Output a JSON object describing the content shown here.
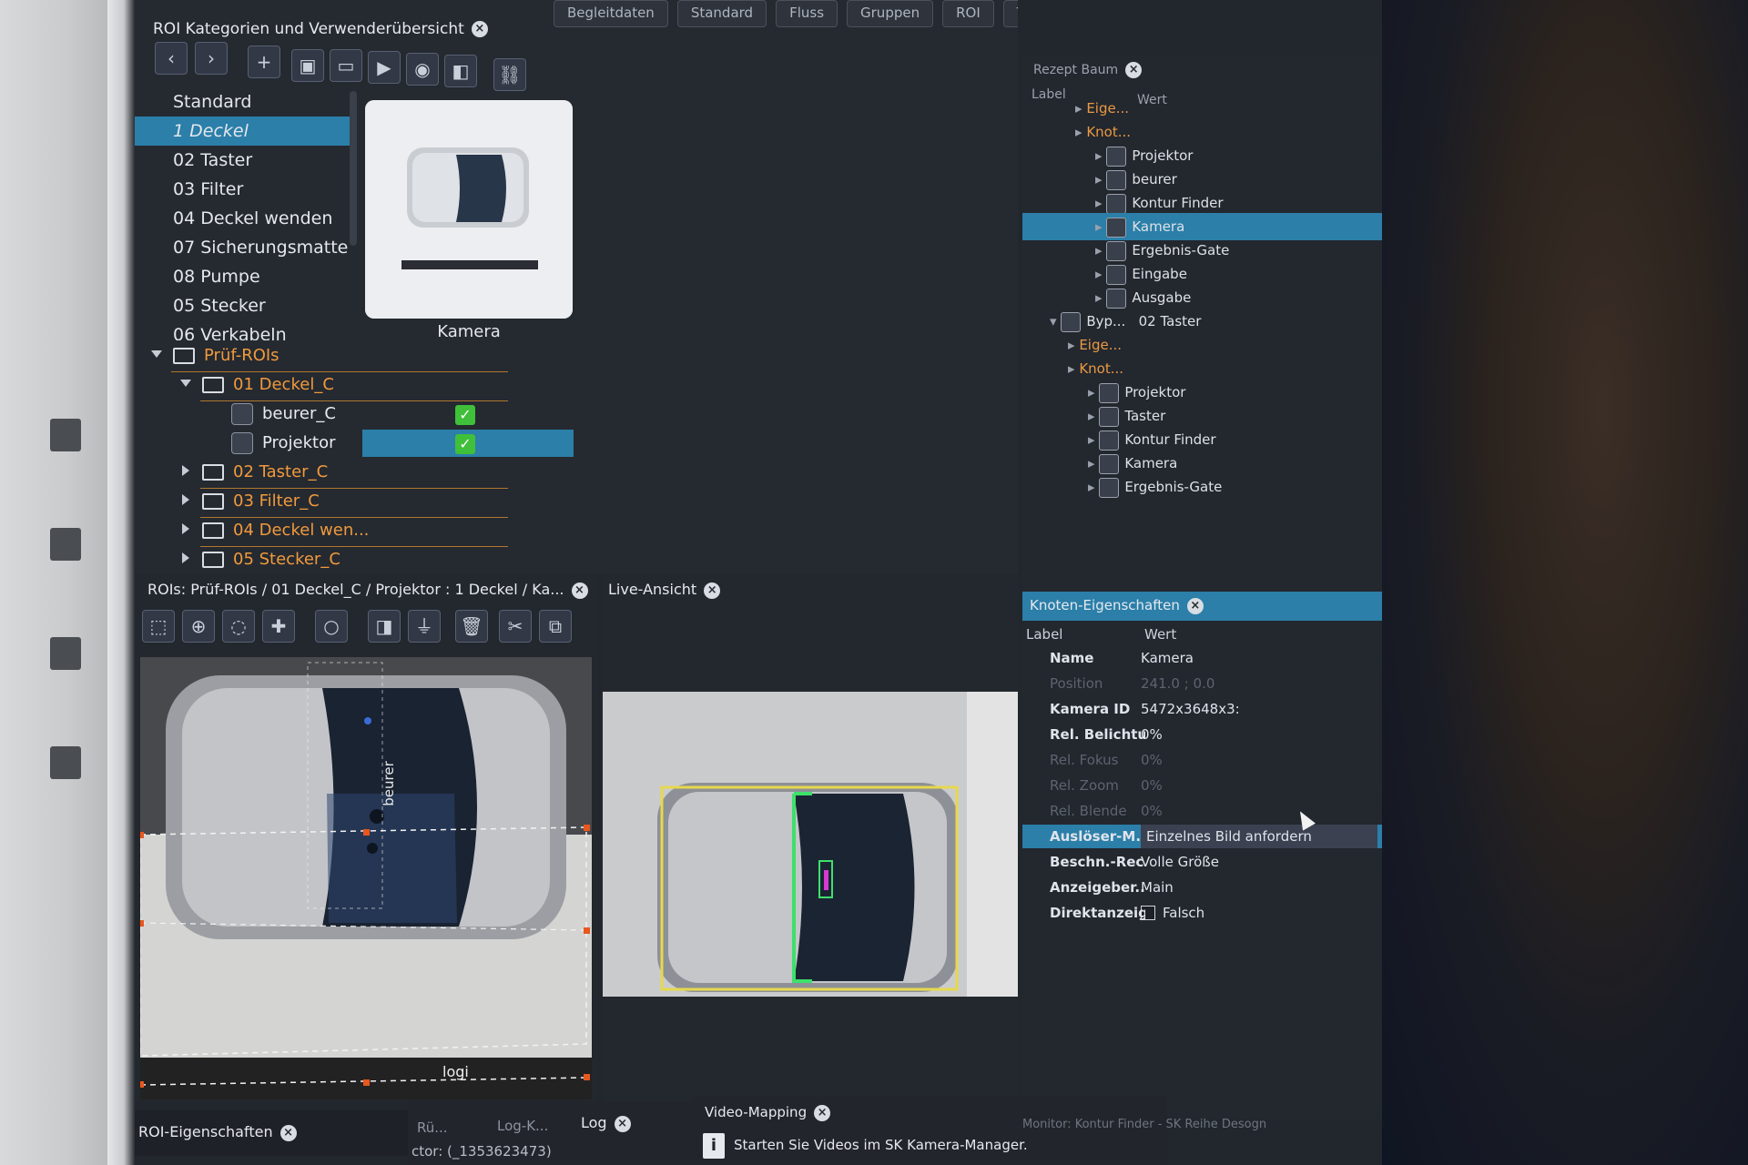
{
  "colors": {
    "accent": "#2b7fa9",
    "orange": "#f09a3d",
    "green": "#3fbf3a",
    "bg": "#22262d"
  },
  "header": {
    "title": "ROI Kategorien und Verwenderübersicht",
    "tabs": [
      "Begleitdaten",
      "Standard",
      "Fluss",
      "Gruppen",
      "ROI",
      "Test"
    ]
  },
  "categories": {
    "items": [
      "Standard",
      "1 Deckel",
      "02 Taster",
      "03 Filter",
      "04 Deckel wenden",
      "07 Sicherungsmatte",
      "08 Pumpe",
      "05 Stecker",
      "06 Verkabeln"
    ],
    "selected_index": 1,
    "thumbnail_label": "Kamera"
  },
  "roi_tree": {
    "root": "Prüf-ROIs",
    "group1": "01 Deckel_C",
    "child1": "beurer_C",
    "child2": "Projektor",
    "folders": [
      "02 Taster_C",
      "03 Filter_C",
      "04 Deckel wen...",
      "05 Stecker_C"
    ]
  },
  "roi_editor": {
    "title": "ROIs: Prüf-ROIs / 01 Deckel_C / Projektor : 1 Deckel / Ka...",
    "image_text_beurer": "beurer",
    "image_text_logi": "logi"
  },
  "live_view": {
    "title": "Live-Ansicht"
  },
  "recipe_tree": {
    "title": "Rezept Baum",
    "col_label": "Label",
    "col_value": "Wert",
    "rows": [
      {
        "text": "Eige...",
        "kind": "orange"
      },
      {
        "text": "Knot...",
        "kind": "orange"
      },
      {
        "text": "Projektor",
        "kind": "node"
      },
      {
        "text": "beurer",
        "kind": "node"
      },
      {
        "text": "Kontur Finder",
        "kind": "node"
      },
      {
        "text": "Kamera",
        "kind": "node-selected"
      },
      {
        "text": "Ergebnis-Gate",
        "kind": "node"
      },
      {
        "text": "Eingabe",
        "kind": "node"
      },
      {
        "text": "Ausgabe",
        "kind": "node"
      }
    ],
    "byp_label": "Byp...",
    "byp_value": "02 Taster",
    "rows2": [
      {
        "text": "Eige...",
        "kind": "orange"
      },
      {
        "text": "Knot...",
        "kind": "orange"
      },
      {
        "text": "Projektor",
        "kind": "node"
      },
      {
        "text": "Taster",
        "kind": "node"
      },
      {
        "text": "Kontur Finder",
        "kind": "node"
      },
      {
        "text": "Kamera",
        "kind": "node"
      },
      {
        "text": "Ergebnis-Gate",
        "kind": "node"
      }
    ]
  },
  "node_props": {
    "title": "Knoten-Eigenschaften",
    "col_label": "Label",
    "col_value": "Wert",
    "rows": [
      {
        "label": "Name",
        "value": "Kamera",
        "dim": false
      },
      {
        "label": "Position",
        "value": "241.0 ; 0.0",
        "dim": true
      },
      {
        "label": "Kamera ID",
        "value": "5472x3648x3:",
        "dim": false
      },
      {
        "label": "Rel. Belichtu...",
        "value": "0%",
        "dim": false
      },
      {
        "label": "Rel. Fokus",
        "value": "0%",
        "dim": true
      },
      {
        "label": "Rel. Zoom",
        "value": "0%",
        "dim": true
      },
      {
        "label": "Rel. Blende",
        "value": "0%",
        "dim": true
      },
      {
        "label": "Auslöser-M...",
        "value": "Einzelnes Bild anfordern",
        "dim": false
      },
      {
        "label": "Beschn.-Rec...",
        "value": "Volle Größe",
        "dim": false
      },
      {
        "label": "Anzeigeber...",
        "value": "Main",
        "dim": false
      },
      {
        "label": "Direktanzeige",
        "value": "Falsch",
        "dim": false
      }
    ]
  },
  "bottom": {
    "roi_props": "ROI-Eigenschaften",
    "ru": "Rü...",
    "log_k": "Log-K...",
    "log": "Log",
    "ctor": "ctor: (_1353623473)",
    "video_mapping": "Video-Mapping",
    "video_msg": "Starten Sie Videos im SK Kamera-Manager.",
    "monitor": "Monitor: Kontur Finder - SK Reihe Desogn"
  }
}
